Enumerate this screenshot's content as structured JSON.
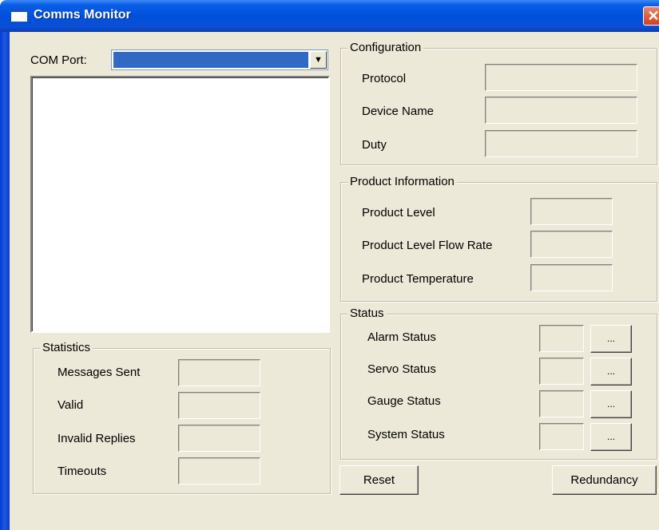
{
  "window": {
    "title": "Comms Monitor",
    "close_glyph": "✕"
  },
  "com_port": {
    "label": "COM Port:",
    "value": ""
  },
  "configuration": {
    "title": "Configuration",
    "fields": [
      {
        "label": "Protocol",
        "value": ""
      },
      {
        "label": "Device Name",
        "value": ""
      },
      {
        "label": "Duty",
        "value": ""
      }
    ]
  },
  "product_information": {
    "title": "Product Information",
    "fields": [
      {
        "label": "Product Level",
        "value": ""
      },
      {
        "label": "Product Level Flow Rate",
        "value": ""
      },
      {
        "label": "Product Temperature",
        "value": ""
      }
    ]
  },
  "status": {
    "title": "Status",
    "items": [
      {
        "label": "Alarm Status",
        "value": "",
        "button": "..."
      },
      {
        "label": "Servo Status",
        "value": "",
        "button": "..."
      },
      {
        "label": "Gauge Status",
        "value": "",
        "button": "..."
      },
      {
        "label": "System Status",
        "value": "",
        "button": "..."
      }
    ]
  },
  "statistics": {
    "title": "Statistics",
    "fields": [
      {
        "label": "Messages Sent",
        "value": ""
      },
      {
        "label": "Valid",
        "value": ""
      },
      {
        "label": "Invalid Replies",
        "value": ""
      },
      {
        "label": "Timeouts",
        "value": ""
      }
    ]
  },
  "buttons": {
    "reset": "Reset",
    "redundancy": "Redundancy"
  }
}
